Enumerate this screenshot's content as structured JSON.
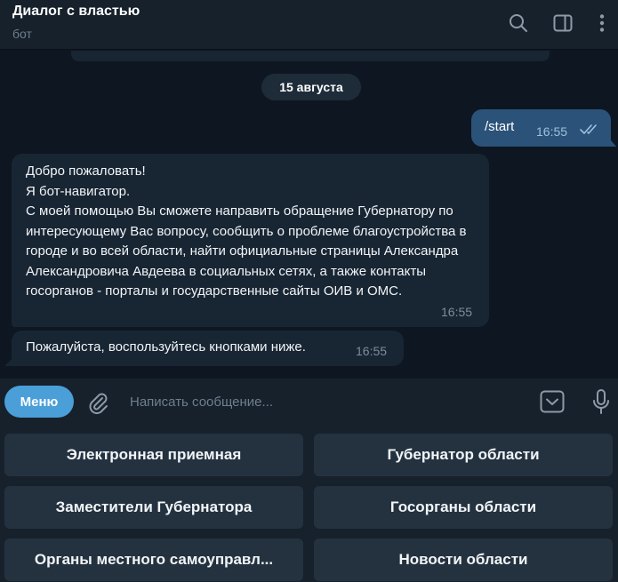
{
  "header": {
    "title": "Диалог с властью",
    "subtitle": "бот",
    "icons": [
      "search-icon",
      "sidebar-toggle-icon",
      "more-vertical-icon"
    ]
  },
  "chat": {
    "date": "15 августа",
    "outgoing": {
      "text": "/start",
      "time": "16:55",
      "status": "read"
    },
    "incoming": [
      {
        "text": "Добро пожаловать!\nЯ бот-навигатор.\nС моей помощью Вы сможете направить обращение Губернатору по интересующему Вас вопросу, сообщить о проблеме благоустройства в городе и во всей области, найти официальные страницы Александра Александровича Авдеева в социальных сетях, а также контакты госорганов - порталы и государственные сайты ОИВ и ОМС.",
        "time": "16:55"
      },
      {
        "text": "Пожалуйста, воспользуйтесь кнопками ниже.",
        "time": "16:55"
      }
    ]
  },
  "composer": {
    "menu_label": "Меню",
    "placeholder": "Написать сообщение...",
    "value": ""
  },
  "keyboard": {
    "buttons": [
      "Электронная приемная",
      "Губернатор области",
      "Заместители Губернатора",
      "Госорганы области",
      "Органы местного самоуправл...",
      "Новости области"
    ]
  },
  "colors": {
    "background": "#0e1621",
    "panel": "#17212b",
    "incoming_bubble": "#182533",
    "outgoing_bubble": "#2b5278",
    "accent": "#4a9fd9",
    "keyboard_button": "#243240"
  }
}
